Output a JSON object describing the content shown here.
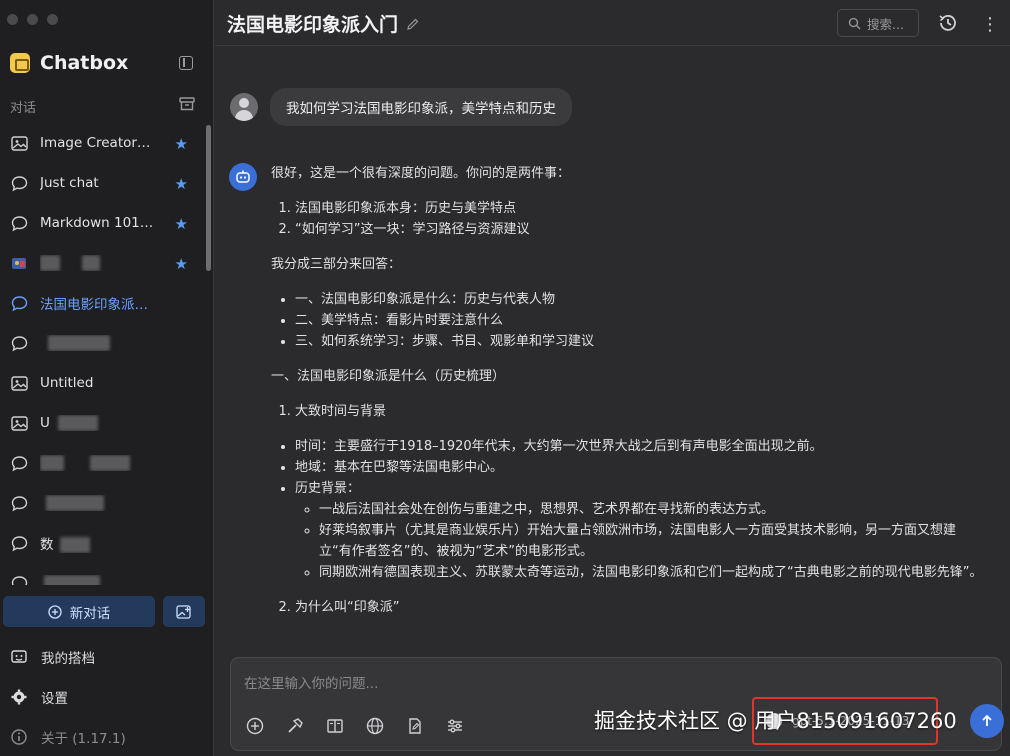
{
  "sidebar": {
    "app_name": "Chatbox",
    "section_label": "对话",
    "items": [
      {
        "label": "Image Creator…",
        "icon": "image-icon",
        "starred": true
      },
      {
        "label": "Just chat",
        "icon": "chat-bubble-icon",
        "starred": true
      },
      {
        "label": "Markdown 101…",
        "icon": "chat-bubble-icon",
        "starred": true
      },
      {
        "label": "",
        "icon": "custom-avatar-icon",
        "starred": true
      },
      {
        "label": "法国电影印象派…",
        "icon": "chat-bubble-icon",
        "starred": false,
        "active": true
      },
      {
        "label": "",
        "icon": "chat-bubble-icon",
        "starred": false
      },
      {
        "label": "Untitled",
        "icon": "image-icon",
        "starred": false
      },
      {
        "label": "U",
        "icon": "image-icon",
        "starred": false
      },
      {
        "label": "",
        "icon": "chat-bubble-icon",
        "starred": false
      },
      {
        "label": "",
        "icon": "chat-bubble-icon",
        "starred": false
      },
      {
        "label": "数",
        "icon": "chat-bubble-icon",
        "starred": false
      }
    ],
    "new_chat_label": "新对话",
    "my_partner_label": "我的搭档",
    "settings_label": "设置",
    "about_label": "关于 (1.17.1)"
  },
  "header": {
    "title": "法国电影印象派入门",
    "search_placeholder": "搜索..."
  },
  "conversation": {
    "user_message": "我如何学习法国电影印象派，美学特点和历史",
    "answer": {
      "intro": "很好，这是一个很有深度的问题。你问的是两件事：",
      "intro_list": [
        "法国电影印象派本身：历史与美学特点",
        "“如何学习”这一块：学习路径与资源建议"
      ],
      "plan_intro": "我分成三部分来回答：",
      "plan_list": [
        "一、法国电影印象派是什么：历史与代表人物",
        "二、美学特点：看影片时要注意什么",
        "三、如何系统学习：步骤、书目、观影单和学习建议"
      ],
      "section1_title": "一、法国电影印象派是什么（历史梳理）",
      "sub1_title": "大致时间与背景",
      "bullets": [
        "时间：主要盛行于1918–1920年代末，大约第一次世界大战之后到有声电影全面出现之前。",
        "地域：基本在巴黎等法国电影中心。",
        "历史背景："
      ],
      "background_list": [
        "一战后法国社会处在创伤与重建之中，思想界、艺术界都在寻找新的表达方式。",
        "好莱坞叙事片（尤其是商业娱乐片）开始大量占领欧洲市场，法国电影人一方面受其技术影响，另一方面又想建立“有作者签名”的、被视为“艺术”的电影形式。",
        "同期欧洲有德国表现主义、苏联蒙太奇等运动，法国电影印象派和它们一起构成了“古典电影之前的现代电影先锋”。"
      ],
      "sub2_title": "为什么叫“印象派”"
    }
  },
  "composer": {
    "placeholder": "在这里输入你的问题...",
    "model_label": "gpt-5.1-2025-11-13"
  },
  "watermark": "掘金技术社区 @ 用户815091607260",
  "colors": {
    "accent": "#3b6fd8",
    "active_text": "#6aa0ff",
    "star": "#5b9cf5",
    "highlight_box": "#e0352b"
  }
}
